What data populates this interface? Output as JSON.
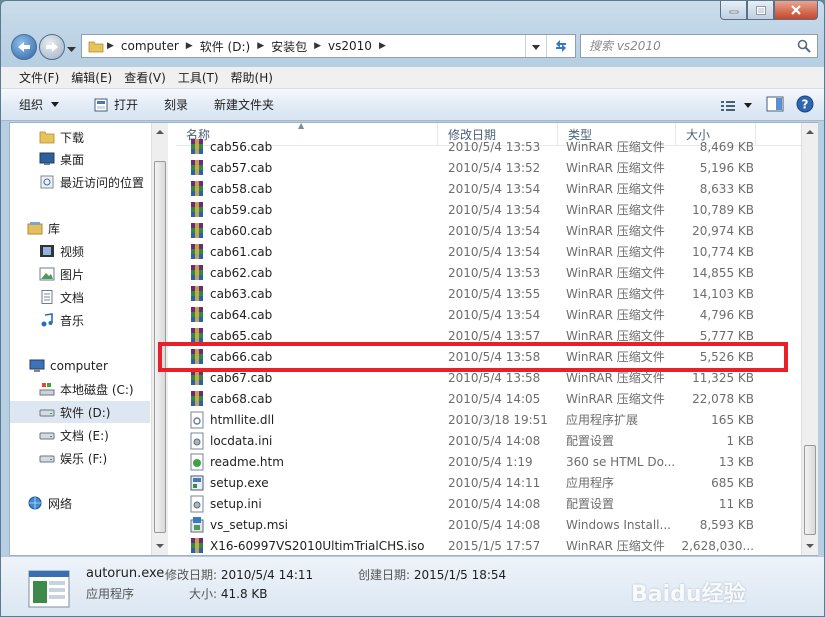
{
  "address": {
    "crumbs": [
      "computer",
      "软件 (D:)",
      "安装包",
      "vs2010"
    ]
  },
  "search": {
    "placeholder": "搜索 vs2010"
  },
  "menu": [
    "文件(F)",
    "编辑(E)",
    "查看(V)",
    "工具(T)",
    "帮助(H)"
  ],
  "toolbar": {
    "organize": "组织",
    "open": "打开",
    "burn": "刻录",
    "new_folder": "新建文件夹"
  },
  "nav": [
    {
      "label": "下载",
      "icon": "folder-icon"
    },
    {
      "label": "桌面",
      "icon": "desktop-icon"
    },
    {
      "label": "最近访问的位置",
      "icon": "recent-places-icon"
    },
    {
      "label": "库",
      "icon": "library-icon"
    },
    {
      "label": "视频",
      "icon": "video-icon"
    },
    {
      "label": "图片",
      "icon": "picture-icon"
    },
    {
      "label": "文档",
      "icon": "document-icon"
    },
    {
      "label": "音乐",
      "icon": "music-icon"
    },
    {
      "label": "computer",
      "icon": "computer-icon"
    },
    {
      "label": "本地磁盘 (C:)",
      "icon": "system-drive-icon"
    },
    {
      "label": "软件 (D:)",
      "icon": "drive-icon"
    },
    {
      "label": "文档 (E:)",
      "icon": "drive-icon"
    },
    {
      "label": "娱乐 (F:)",
      "icon": "drive-icon"
    },
    {
      "label": "网络",
      "icon": "network-icon"
    }
  ],
  "columns": {
    "name": "名称",
    "date": "修改日期",
    "type": "类型",
    "size": "大小"
  },
  "files": [
    {
      "name": "cab56.cab",
      "date": "2010/5/4 13:53",
      "type": "WinRAR 压缩文件",
      "size": "8,469 KB",
      "icon": "winrar"
    },
    {
      "name": "cab57.cab",
      "date": "2010/5/4 13:52",
      "type": "WinRAR 压缩文件",
      "size": "5,196 KB",
      "icon": "winrar"
    },
    {
      "name": "cab58.cab",
      "date": "2010/5/4 13:54",
      "type": "WinRAR 压缩文件",
      "size": "8,633 KB",
      "icon": "winrar"
    },
    {
      "name": "cab59.cab",
      "date": "2010/5/4 13:54",
      "type": "WinRAR 压缩文件",
      "size": "10,789 KB",
      "icon": "winrar"
    },
    {
      "name": "cab60.cab",
      "date": "2010/5/4 13:54",
      "type": "WinRAR 压缩文件",
      "size": "20,974 KB",
      "icon": "winrar"
    },
    {
      "name": "cab61.cab",
      "date": "2010/5/4 13:54",
      "type": "WinRAR 压缩文件",
      "size": "10,774 KB",
      "icon": "winrar"
    },
    {
      "name": "cab62.cab",
      "date": "2010/5/4 13:53",
      "type": "WinRAR 压缩文件",
      "size": "14,855 KB",
      "icon": "winrar"
    },
    {
      "name": "cab63.cab",
      "date": "2010/5/4 13:55",
      "type": "WinRAR 压缩文件",
      "size": "14,103 KB",
      "icon": "winrar"
    },
    {
      "name": "cab64.cab",
      "date": "2010/5/4 13:54",
      "type": "WinRAR 压缩文件",
      "size": "4,796 KB",
      "icon": "winrar"
    },
    {
      "name": "cab65.cab",
      "date": "2010/5/4 13:57",
      "type": "WinRAR 压缩文件",
      "size": "5,777 KB",
      "icon": "winrar"
    },
    {
      "name": "cab66.cab",
      "date": "2010/5/4 13:58",
      "type": "WinRAR 压缩文件",
      "size": "5,526 KB",
      "icon": "winrar"
    },
    {
      "name": "cab67.cab",
      "date": "2010/5/4 13:58",
      "type": "WinRAR 压缩文件",
      "size": "11,325 KB",
      "icon": "winrar"
    },
    {
      "name": "cab68.cab",
      "date": "2010/5/4 14:05",
      "type": "WinRAR 压缩文件",
      "size": "22,078 KB",
      "icon": "winrar"
    },
    {
      "name": "htmllite.dll",
      "date": "2010/3/18 19:51",
      "type": "应用程序扩展",
      "size": "165 KB",
      "icon": "dll"
    },
    {
      "name": "locdata.ini",
      "date": "2010/5/4 14:08",
      "type": "配置设置",
      "size": "1 KB",
      "icon": "ini"
    },
    {
      "name": "readme.htm",
      "date": "2010/5/4 1:19",
      "type": "360 se HTML Do...",
      "size": "13 KB",
      "icon": "htm"
    },
    {
      "name": "setup.exe",
      "date": "2010/5/4 14:11",
      "type": "应用程序",
      "size": "685 KB",
      "icon": "exe"
    },
    {
      "name": "setup.ini",
      "date": "2010/5/4 14:08",
      "type": "配置设置",
      "size": "11 KB",
      "icon": "ini"
    },
    {
      "name": "vs_setup.msi",
      "date": "2010/5/4 14:08",
      "type": "Windows Install...",
      "size": "8,593 KB",
      "icon": "msi"
    },
    {
      "name": "X16-60997VS2010UltimTrialCHS.iso",
      "date": "2015/1/5 17:57",
      "type": "WinRAR 压缩文件",
      "size": "2,628,030...",
      "icon": "winrar"
    }
  ],
  "details": {
    "name": "autorun.exe",
    "type": "应用程序",
    "modified_label": "修改日期:",
    "modified": "2010/5/4 14:11",
    "size_label": "大小:",
    "size": "41.8 KB",
    "created_label": "创建日期:",
    "created": "2015/1/5 18:54"
  },
  "watermark": "Baidu经验",
  "colors": {
    "highlight": "#e8202a",
    "selection": "#dde7f2"
  }
}
